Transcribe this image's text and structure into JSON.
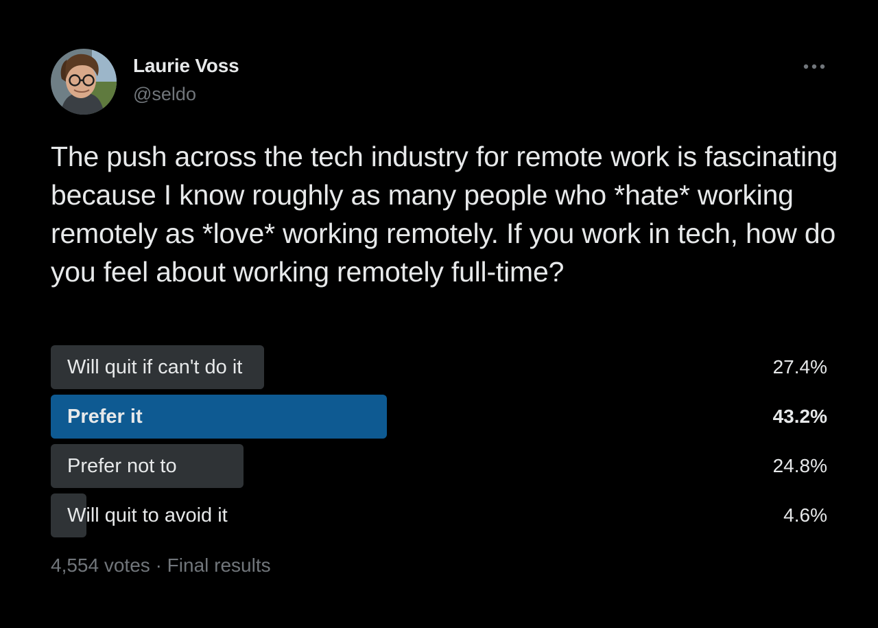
{
  "colors": {
    "background": "#000000",
    "text_primary": "#e7e9ea",
    "text_secondary": "#71767b",
    "poll_bar": "#2f3336",
    "poll_bar_winner": "#0e5a92"
  },
  "author": {
    "name": "Laurie Voss",
    "handle": "@seldo",
    "avatar_icon": "profile-photo"
  },
  "more_icon": "ellipsis-horizontal-icon",
  "tweet": {
    "text": "The push across the tech industry for remote work is fascinating because I know roughly as many people who *hate* working remotely as *love* working remotely. If you work in tech, how do you feel about working remotely full-time?"
  },
  "poll": {
    "options": [
      {
        "label": "Will quit if can't do it",
        "percent_text": "27.4%",
        "percent": 27.4,
        "winner": false
      },
      {
        "label": "Prefer it",
        "percent_text": "43.2%",
        "percent": 43.2,
        "winner": true
      },
      {
        "label": "Prefer not to",
        "percent_text": "24.8%",
        "percent": 24.8,
        "winner": false
      },
      {
        "label": "Will quit to avoid it",
        "percent_text": "4.6%",
        "percent": 4.6,
        "winner": false
      }
    ],
    "votes": "4,554 votes",
    "separator": "·",
    "status": "Final results"
  }
}
